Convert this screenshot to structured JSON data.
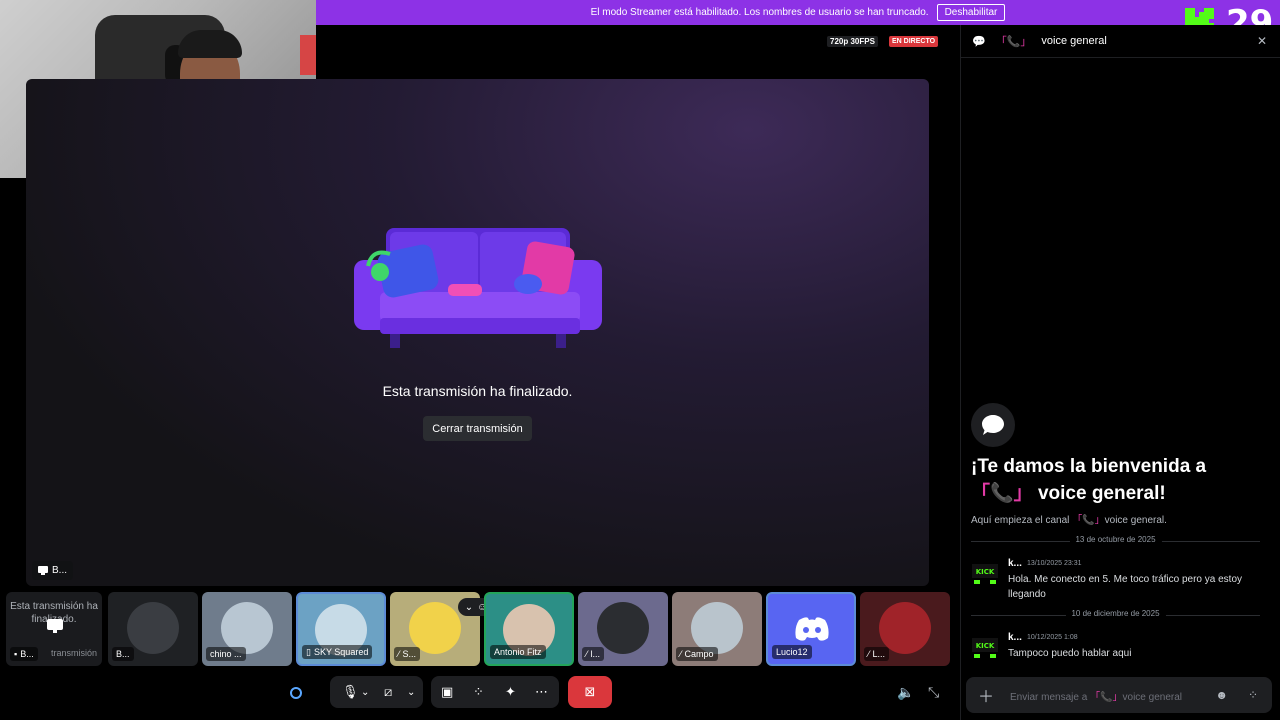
{
  "banner": {
    "text": "El modo Streamer está habilitado. Los nombres de usuario se han truncado.",
    "button": "Deshabilitar"
  },
  "stream": {
    "resolution": "720p 30FPS",
    "live": "EN DIRECTO",
    "ended_message": "Esta transmisión ha finalizado.",
    "close_button": "Cerrar transmisión",
    "streamer_tag": "B..."
  },
  "tiles": [
    {
      "label": "B...",
      "extra": "transmisión",
      "ended": "Esta transmisión ha finalizado."
    },
    {
      "label": "B..."
    },
    {
      "label": "chino ..."
    },
    {
      "label": "SKY Squared"
    },
    {
      "label": "S..."
    },
    {
      "label": "Antonio Fitz"
    },
    {
      "label": "l..."
    },
    {
      "label": "Campo"
    },
    {
      "label": "Lucio12"
    },
    {
      "label": "L..."
    }
  ],
  "overlay": {
    "kick_count": "29"
  },
  "chat": {
    "channel": "voice general",
    "welcome_title_line1": "¡Te damos la bienvenida a",
    "welcome_title_line2": "voice general!",
    "welcome_sub_prefix": "Aquí empieza el canal",
    "welcome_sub_channel": "voice general.",
    "dividers": [
      "13 de octubre de 2025",
      "10 de diciembre de 2025"
    ],
    "messages": [
      {
        "name": "k...",
        "time": "13/10/2025 23:31",
        "text": "Hola. Me conecto en 5. Me toco tráfico pero ya estoy llegando"
      },
      {
        "name": "k...",
        "time": "10/12/2025 1:08",
        "text": "Tampoco puedo hablar aqui"
      }
    ],
    "input_placeholder": "Enviar mensaje a",
    "input_channel": "voice general"
  },
  "colors": {
    "banner": "#8d32e6",
    "live": "#da373c",
    "end_call": "#da373c",
    "kick_green": "#53fc18"
  }
}
